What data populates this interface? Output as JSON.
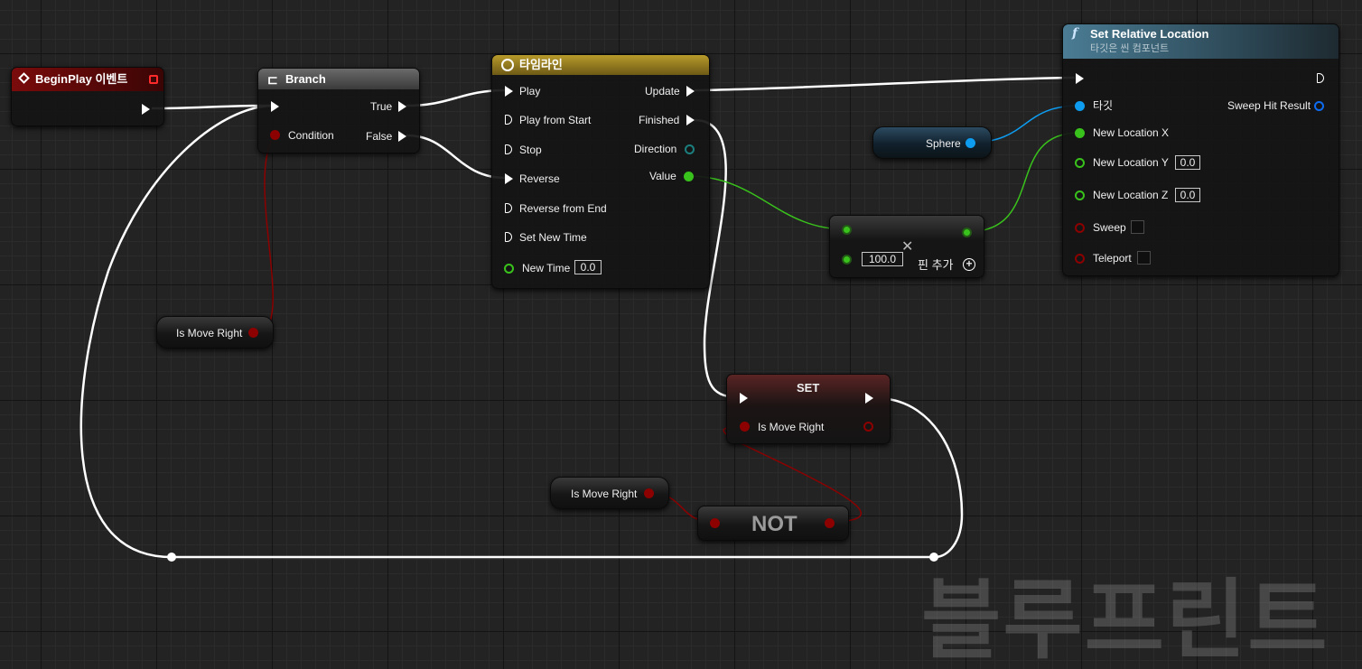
{
  "watermark": "블루프린트",
  "begin_play": {
    "title": "BeginPlay 이벤트"
  },
  "branch": {
    "title": "Branch",
    "true_label": "True",
    "condition_label": "Condition",
    "false_label": "False"
  },
  "timeline": {
    "title": "타임라인",
    "inputs": [
      "Play",
      "Play from Start",
      "Stop",
      "Reverse",
      "Reverse from End",
      "Set New Time"
    ],
    "new_time_label": "New Time",
    "new_time_value": "0.0",
    "outputs": [
      "Update",
      "Finished",
      "Direction",
      "Value"
    ]
  },
  "set_relative_location": {
    "title": "Set Relative Location",
    "subtitle": "타깃은 씬 컴포넌트",
    "target_label": "타깃",
    "sweep_hit_result_label": "Sweep Hit Result",
    "new_location_x_label": "New Location X",
    "new_location_y_label": "New Location Y",
    "new_location_y_value": "0.0",
    "new_location_z_label": "New Location Z",
    "new_location_z_value": "0.0",
    "sweep_label": "Sweep",
    "teleport_label": "Teleport"
  },
  "sphere": {
    "label": "Sphere"
  },
  "add_node": {
    "value": "100.0",
    "add_pin_label": "핀 추가"
  },
  "is_move_right_getter_1": {
    "label": "Is Move Right"
  },
  "is_move_right_getter_2": {
    "label": "Is Move Right"
  },
  "set_node": {
    "title": "SET",
    "var_label": "Is Move Right"
  },
  "not_node": {
    "title": "NOT"
  },
  "colors": {
    "exec": "#ffffff",
    "bool": "#8c0000",
    "float": "#39c21c",
    "object": "#0e9cf0",
    "timeline_header": "#8a7420",
    "function_header": "#3b6478"
  }
}
